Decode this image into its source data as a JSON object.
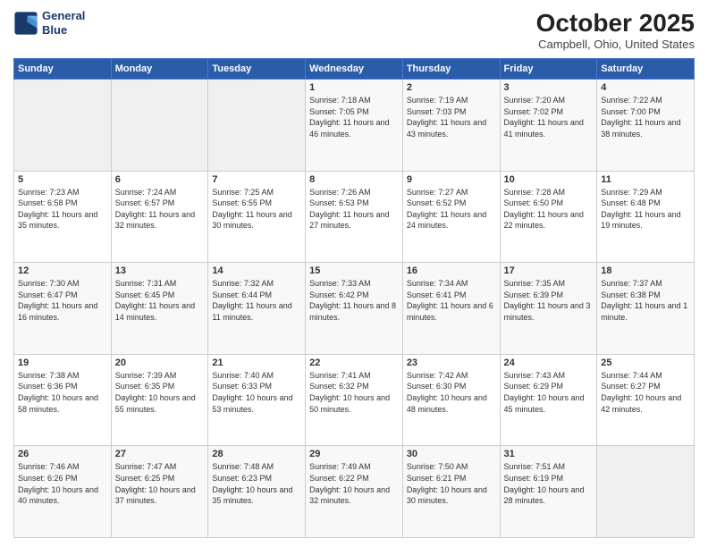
{
  "header": {
    "logo_line1": "General",
    "logo_line2": "Blue",
    "title": "October 2025",
    "location": "Campbell, Ohio, United States"
  },
  "days_of_week": [
    "Sunday",
    "Monday",
    "Tuesday",
    "Wednesday",
    "Thursday",
    "Friday",
    "Saturday"
  ],
  "weeks": [
    [
      {
        "day": "",
        "empty": true
      },
      {
        "day": "",
        "empty": true
      },
      {
        "day": "",
        "empty": true
      },
      {
        "day": "1",
        "sunrise": "7:18 AM",
        "sunset": "7:05 PM",
        "daylight": "11 hours and 46 minutes."
      },
      {
        "day": "2",
        "sunrise": "7:19 AM",
        "sunset": "7:03 PM",
        "daylight": "11 hours and 43 minutes."
      },
      {
        "day": "3",
        "sunrise": "7:20 AM",
        "sunset": "7:02 PM",
        "daylight": "11 hours and 41 minutes."
      },
      {
        "day": "4",
        "sunrise": "7:22 AM",
        "sunset": "7:00 PM",
        "daylight": "11 hours and 38 minutes."
      }
    ],
    [
      {
        "day": "5",
        "sunrise": "7:23 AM",
        "sunset": "6:58 PM",
        "daylight": "11 hours and 35 minutes."
      },
      {
        "day": "6",
        "sunrise": "7:24 AM",
        "sunset": "6:57 PM",
        "daylight": "11 hours and 32 minutes."
      },
      {
        "day": "7",
        "sunrise": "7:25 AM",
        "sunset": "6:55 PM",
        "daylight": "11 hours and 30 minutes."
      },
      {
        "day": "8",
        "sunrise": "7:26 AM",
        "sunset": "6:53 PM",
        "daylight": "11 hours and 27 minutes."
      },
      {
        "day": "9",
        "sunrise": "7:27 AM",
        "sunset": "6:52 PM",
        "daylight": "11 hours and 24 minutes."
      },
      {
        "day": "10",
        "sunrise": "7:28 AM",
        "sunset": "6:50 PM",
        "daylight": "11 hours and 22 minutes."
      },
      {
        "day": "11",
        "sunrise": "7:29 AM",
        "sunset": "6:48 PM",
        "daylight": "11 hours and 19 minutes."
      }
    ],
    [
      {
        "day": "12",
        "sunrise": "7:30 AM",
        "sunset": "6:47 PM",
        "daylight": "11 hours and 16 minutes."
      },
      {
        "day": "13",
        "sunrise": "7:31 AM",
        "sunset": "6:45 PM",
        "daylight": "11 hours and 14 minutes."
      },
      {
        "day": "14",
        "sunrise": "7:32 AM",
        "sunset": "6:44 PM",
        "daylight": "11 hours and 11 minutes."
      },
      {
        "day": "15",
        "sunrise": "7:33 AM",
        "sunset": "6:42 PM",
        "daylight": "11 hours and 8 minutes."
      },
      {
        "day": "16",
        "sunrise": "7:34 AM",
        "sunset": "6:41 PM",
        "daylight": "11 hours and 6 minutes."
      },
      {
        "day": "17",
        "sunrise": "7:35 AM",
        "sunset": "6:39 PM",
        "daylight": "11 hours and 3 minutes."
      },
      {
        "day": "18",
        "sunrise": "7:37 AM",
        "sunset": "6:38 PM",
        "daylight": "11 hours and 1 minute."
      }
    ],
    [
      {
        "day": "19",
        "sunrise": "7:38 AM",
        "sunset": "6:36 PM",
        "daylight": "10 hours and 58 minutes."
      },
      {
        "day": "20",
        "sunrise": "7:39 AM",
        "sunset": "6:35 PM",
        "daylight": "10 hours and 55 minutes."
      },
      {
        "day": "21",
        "sunrise": "7:40 AM",
        "sunset": "6:33 PM",
        "daylight": "10 hours and 53 minutes."
      },
      {
        "day": "22",
        "sunrise": "7:41 AM",
        "sunset": "6:32 PM",
        "daylight": "10 hours and 50 minutes."
      },
      {
        "day": "23",
        "sunrise": "7:42 AM",
        "sunset": "6:30 PM",
        "daylight": "10 hours and 48 minutes."
      },
      {
        "day": "24",
        "sunrise": "7:43 AM",
        "sunset": "6:29 PM",
        "daylight": "10 hours and 45 minutes."
      },
      {
        "day": "25",
        "sunrise": "7:44 AM",
        "sunset": "6:27 PM",
        "daylight": "10 hours and 42 minutes."
      }
    ],
    [
      {
        "day": "26",
        "sunrise": "7:46 AM",
        "sunset": "6:26 PM",
        "daylight": "10 hours and 40 minutes."
      },
      {
        "day": "27",
        "sunrise": "7:47 AM",
        "sunset": "6:25 PM",
        "daylight": "10 hours and 37 minutes."
      },
      {
        "day": "28",
        "sunrise": "7:48 AM",
        "sunset": "6:23 PM",
        "daylight": "10 hours and 35 minutes."
      },
      {
        "day": "29",
        "sunrise": "7:49 AM",
        "sunset": "6:22 PM",
        "daylight": "10 hours and 32 minutes."
      },
      {
        "day": "30",
        "sunrise": "7:50 AM",
        "sunset": "6:21 PM",
        "daylight": "10 hours and 30 minutes."
      },
      {
        "day": "31",
        "sunrise": "7:51 AM",
        "sunset": "6:19 PM",
        "daylight": "10 hours and 28 minutes."
      },
      {
        "day": "",
        "empty": true
      }
    ]
  ]
}
